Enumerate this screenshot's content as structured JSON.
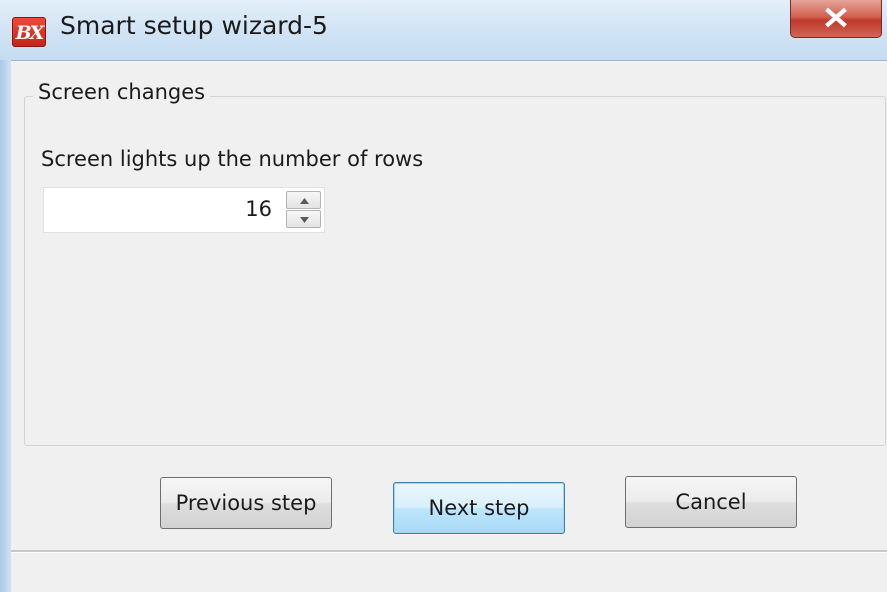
{
  "window": {
    "title": "Smart setup wizard-5",
    "app_icon_text": "BX",
    "close_icon": "close-icon"
  },
  "group": {
    "title": "Screen changes",
    "field_label": "Screen lights up the number of rows",
    "rows_value": "16",
    "spin_up_icon": "arrow-up-icon",
    "spin_down_icon": "arrow-down-icon"
  },
  "buttons": {
    "previous": "Previous step",
    "next": "Next step",
    "cancel": "Cancel"
  },
  "colors": {
    "titlebar": "#d3e5f6",
    "close_button": "#c0392b",
    "app_icon": "#d8362a",
    "client_background": "#f0f0f0",
    "default_button_border": "#3c7fb1"
  }
}
